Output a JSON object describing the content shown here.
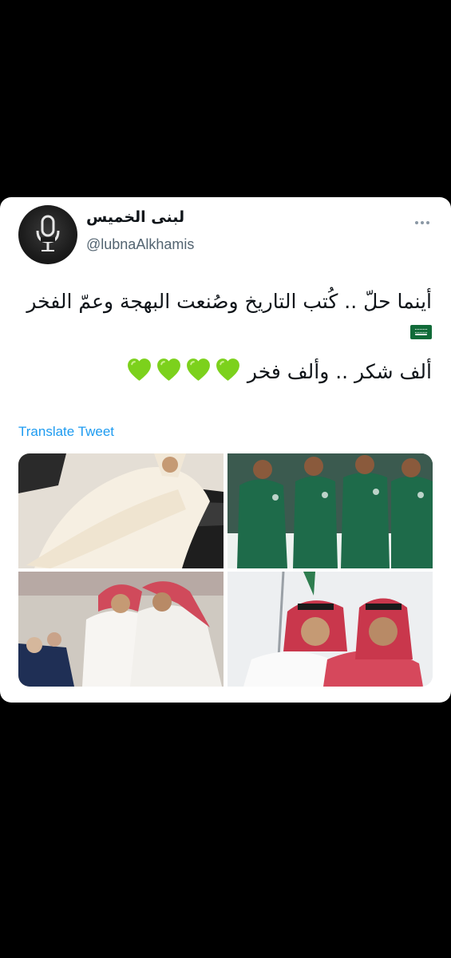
{
  "tweet": {
    "author_name": "لبنى الخميس",
    "handle": "@lubnaAlkhamis",
    "more_icon": "more-horizontal-icon",
    "text_line1": "أينما حلّ .. كُتب التاريخ وصُنعت البهجة وعمّ الفخر",
    "text_line2": "ألف شكر .. وألف فخر",
    "flag_icon": "saudi-flag-emoji",
    "heart_icon": "green-heart-emoji",
    "heart_count": 4,
    "translate_label": "Translate Tweet",
    "colors": {
      "link": "#1d9bf0",
      "text": "#0f1419",
      "muted": "#536471",
      "heart": "#7cd11c",
      "flag": "#116b39"
    }
  }
}
